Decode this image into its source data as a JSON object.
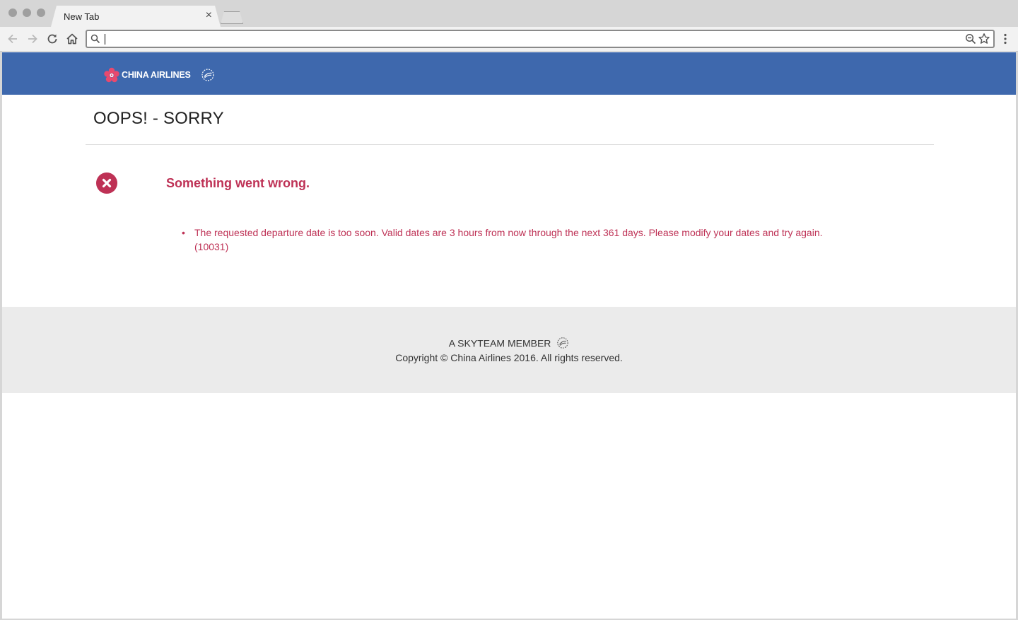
{
  "browser": {
    "tab_title": "New Tab",
    "tab_close": "×",
    "address_value": "",
    "colors": {
      "chrome": "#d6d6d6",
      "toolbar": "#f2f2f2"
    }
  },
  "site": {
    "brand_name": "CHINA AIRLINES",
    "colors": {
      "banner": "#3e68ad",
      "error": "#be3155",
      "footer": "#ebebeb"
    }
  },
  "main": {
    "heading": "OOPS! - SORRY",
    "error_title": "Something went wrong.",
    "errors": [
      "The requested departure date is too soon.  Valid dates are 3 hours from now through the next 361 days.  Please modify your dates and try again. (10031)"
    ],
    "bullet": "•"
  },
  "footer": {
    "skyteam": "A SKYTEAM MEMBER",
    "copyright": "Copyright © China Airlines 2016. All rights reserved."
  },
  "icons": [
    "back-icon",
    "forward-icon",
    "reload-icon",
    "home-icon",
    "search-icon",
    "zoom-icon",
    "star-icon",
    "menu-icon",
    "plum-blossom-logo-icon",
    "skyteam-icon",
    "error-x-icon"
  ]
}
